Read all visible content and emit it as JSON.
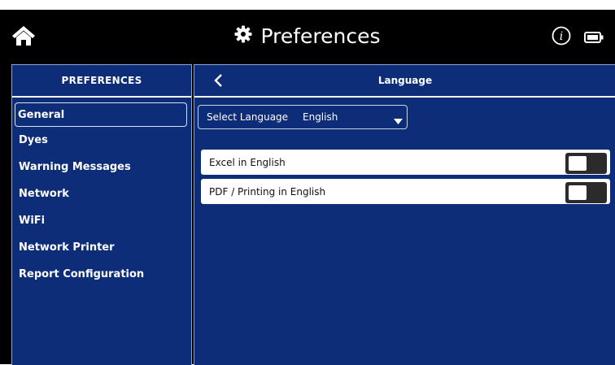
{
  "header": {
    "title": "Preferences",
    "home_icon": "home-icon",
    "title_icon": "gear-icon",
    "info_icon": "info-icon",
    "battery_icon": "battery-icon"
  },
  "sidebar": {
    "title": "PREFERENCES",
    "items": [
      {
        "label": "General",
        "active": true
      },
      {
        "label": "Dyes"
      },
      {
        "label": "Warning Messages"
      },
      {
        "label": "Network"
      },
      {
        "label": "WiFi"
      },
      {
        "label": "Network Printer"
      },
      {
        "label": "Report Configuration"
      }
    ]
  },
  "main": {
    "title": "Language",
    "back_icon": "chevron-left-icon",
    "language_select": {
      "label": "Select Language",
      "value": "English",
      "icon": "caret-down-icon"
    },
    "toggles": [
      {
        "label": "Excel in English",
        "on": false
      },
      {
        "label": "PDF / Printing in English",
        "on": false
      }
    ]
  },
  "colors": {
    "panel_bg": "#0d2d78",
    "header_bg": "#000000",
    "text_light": "#ffffff",
    "row_bg": "#ffffff",
    "switch_off": "#2b2b2b"
  }
}
